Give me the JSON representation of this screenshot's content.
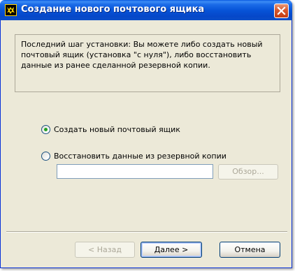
{
  "window": {
    "title": "Создание нового почтового ящика"
  },
  "info": {
    "text": "Последний шаг установки: Вы можете либо создать новый почтовый ящик (установка \"с нуля\"), либо восстановить данные из ранее сделанной резервной копии."
  },
  "options": {
    "create_new": {
      "label": "Создать новый почтовый ящик",
      "selected": true
    },
    "restore": {
      "label": "Восстановить данные из резервной копии",
      "selected": false
    }
  },
  "restore_path": {
    "value": "",
    "browse_label": "Обзор..."
  },
  "buttons": {
    "back_label": "< Назад",
    "next_label": "Далее  >",
    "cancel_label": "Отмена"
  },
  "colors": {
    "titlebar": "#0754d8",
    "dialog_bg": "#ece9d8",
    "radio_selected": "#21a121",
    "close_button": "#d8572d"
  },
  "icons": {
    "app": "app-icon",
    "close": "close-icon"
  }
}
